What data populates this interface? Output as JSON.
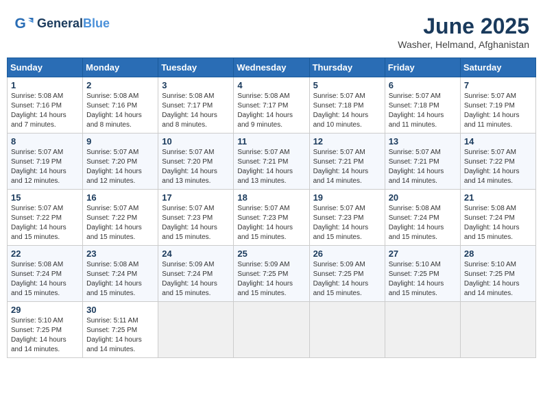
{
  "header": {
    "logo_line1": "General",
    "logo_line2": "Blue",
    "month_year": "June 2025",
    "location": "Washer, Helmand, Afghanistan"
  },
  "weekdays": [
    "Sunday",
    "Monday",
    "Tuesday",
    "Wednesday",
    "Thursday",
    "Friday",
    "Saturday"
  ],
  "weeks": [
    [
      {
        "day": "1",
        "sunrise": "5:08 AM",
        "sunset": "7:16 PM",
        "daylight": "14 hours and 7 minutes."
      },
      {
        "day": "2",
        "sunrise": "5:08 AM",
        "sunset": "7:16 PM",
        "daylight": "14 hours and 8 minutes."
      },
      {
        "day": "3",
        "sunrise": "5:08 AM",
        "sunset": "7:17 PM",
        "daylight": "14 hours and 8 minutes."
      },
      {
        "day": "4",
        "sunrise": "5:08 AM",
        "sunset": "7:17 PM",
        "daylight": "14 hours and 9 minutes."
      },
      {
        "day": "5",
        "sunrise": "5:07 AM",
        "sunset": "7:18 PM",
        "daylight": "14 hours and 10 minutes."
      },
      {
        "day": "6",
        "sunrise": "5:07 AM",
        "sunset": "7:18 PM",
        "daylight": "14 hours and 11 minutes."
      },
      {
        "day": "7",
        "sunrise": "5:07 AM",
        "sunset": "7:19 PM",
        "daylight": "14 hours and 11 minutes."
      }
    ],
    [
      {
        "day": "8",
        "sunrise": "5:07 AM",
        "sunset": "7:19 PM",
        "daylight": "14 hours and 12 minutes."
      },
      {
        "day": "9",
        "sunrise": "5:07 AM",
        "sunset": "7:20 PM",
        "daylight": "14 hours and 12 minutes."
      },
      {
        "day": "10",
        "sunrise": "5:07 AM",
        "sunset": "7:20 PM",
        "daylight": "14 hours and 13 minutes."
      },
      {
        "day": "11",
        "sunrise": "5:07 AM",
        "sunset": "7:21 PM",
        "daylight": "14 hours and 13 minutes."
      },
      {
        "day": "12",
        "sunrise": "5:07 AM",
        "sunset": "7:21 PM",
        "daylight": "14 hours and 14 minutes."
      },
      {
        "day": "13",
        "sunrise": "5:07 AM",
        "sunset": "7:21 PM",
        "daylight": "14 hours and 14 minutes."
      },
      {
        "day": "14",
        "sunrise": "5:07 AM",
        "sunset": "7:22 PM",
        "daylight": "14 hours and 14 minutes."
      }
    ],
    [
      {
        "day": "15",
        "sunrise": "5:07 AM",
        "sunset": "7:22 PM",
        "daylight": "14 hours and 15 minutes."
      },
      {
        "day": "16",
        "sunrise": "5:07 AM",
        "sunset": "7:22 PM",
        "daylight": "14 hours and 15 minutes."
      },
      {
        "day": "17",
        "sunrise": "5:07 AM",
        "sunset": "7:23 PM",
        "daylight": "14 hours and 15 minutes."
      },
      {
        "day": "18",
        "sunrise": "5:07 AM",
        "sunset": "7:23 PM",
        "daylight": "14 hours and 15 minutes."
      },
      {
        "day": "19",
        "sunrise": "5:07 AM",
        "sunset": "7:23 PM",
        "daylight": "14 hours and 15 minutes."
      },
      {
        "day": "20",
        "sunrise": "5:08 AM",
        "sunset": "7:24 PM",
        "daylight": "14 hours and 15 minutes."
      },
      {
        "day": "21",
        "sunrise": "5:08 AM",
        "sunset": "7:24 PM",
        "daylight": "14 hours and 15 minutes."
      }
    ],
    [
      {
        "day": "22",
        "sunrise": "5:08 AM",
        "sunset": "7:24 PM",
        "daylight": "14 hours and 15 minutes."
      },
      {
        "day": "23",
        "sunrise": "5:08 AM",
        "sunset": "7:24 PM",
        "daylight": "14 hours and 15 minutes."
      },
      {
        "day": "24",
        "sunrise": "5:09 AM",
        "sunset": "7:24 PM",
        "daylight": "14 hours and 15 minutes."
      },
      {
        "day": "25",
        "sunrise": "5:09 AM",
        "sunset": "7:25 PM",
        "daylight": "14 hours and 15 minutes."
      },
      {
        "day": "26",
        "sunrise": "5:09 AM",
        "sunset": "7:25 PM",
        "daylight": "14 hours and 15 minutes."
      },
      {
        "day": "27",
        "sunrise": "5:10 AM",
        "sunset": "7:25 PM",
        "daylight": "14 hours and 15 minutes."
      },
      {
        "day": "28",
        "sunrise": "5:10 AM",
        "sunset": "7:25 PM",
        "daylight": "14 hours and 14 minutes."
      }
    ],
    [
      {
        "day": "29",
        "sunrise": "5:10 AM",
        "sunset": "7:25 PM",
        "daylight": "14 hours and 14 minutes."
      },
      {
        "day": "30",
        "sunrise": "5:11 AM",
        "sunset": "7:25 PM",
        "daylight": "14 hours and 14 minutes."
      },
      null,
      null,
      null,
      null,
      null
    ]
  ]
}
